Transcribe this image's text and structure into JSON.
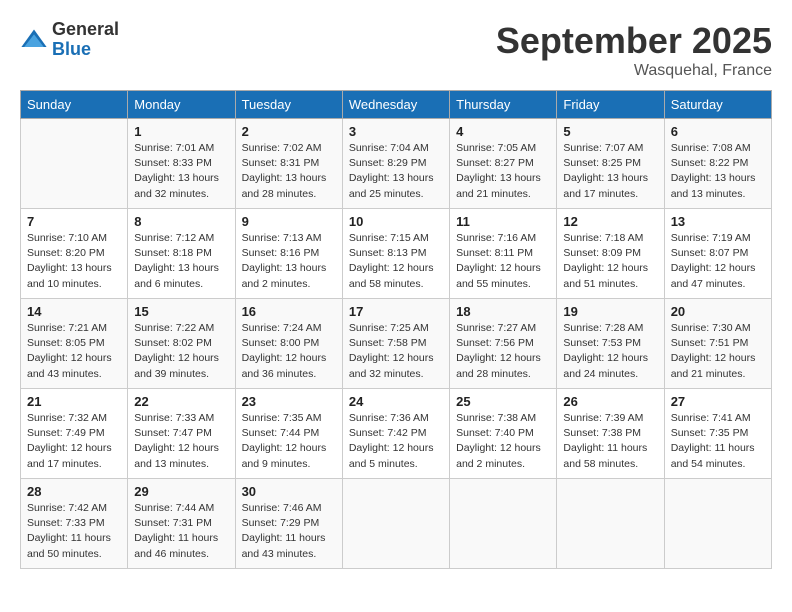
{
  "logo": {
    "general": "General",
    "blue": "Blue"
  },
  "title": "September 2025",
  "subtitle": "Wasquehal, France",
  "days_header": [
    "Sunday",
    "Monday",
    "Tuesday",
    "Wednesday",
    "Thursday",
    "Friday",
    "Saturday"
  ],
  "weeks": [
    [
      {
        "num": "",
        "info": ""
      },
      {
        "num": "1",
        "info": "Sunrise: 7:01 AM\nSunset: 8:33 PM\nDaylight: 13 hours\nand 32 minutes."
      },
      {
        "num": "2",
        "info": "Sunrise: 7:02 AM\nSunset: 8:31 PM\nDaylight: 13 hours\nand 28 minutes."
      },
      {
        "num": "3",
        "info": "Sunrise: 7:04 AM\nSunset: 8:29 PM\nDaylight: 13 hours\nand 25 minutes."
      },
      {
        "num": "4",
        "info": "Sunrise: 7:05 AM\nSunset: 8:27 PM\nDaylight: 13 hours\nand 21 minutes."
      },
      {
        "num": "5",
        "info": "Sunrise: 7:07 AM\nSunset: 8:25 PM\nDaylight: 13 hours\nand 17 minutes."
      },
      {
        "num": "6",
        "info": "Sunrise: 7:08 AM\nSunset: 8:22 PM\nDaylight: 13 hours\nand 13 minutes."
      }
    ],
    [
      {
        "num": "7",
        "info": "Sunrise: 7:10 AM\nSunset: 8:20 PM\nDaylight: 13 hours\nand 10 minutes."
      },
      {
        "num": "8",
        "info": "Sunrise: 7:12 AM\nSunset: 8:18 PM\nDaylight: 13 hours\nand 6 minutes."
      },
      {
        "num": "9",
        "info": "Sunrise: 7:13 AM\nSunset: 8:16 PM\nDaylight: 13 hours\nand 2 minutes."
      },
      {
        "num": "10",
        "info": "Sunrise: 7:15 AM\nSunset: 8:13 PM\nDaylight: 12 hours\nand 58 minutes."
      },
      {
        "num": "11",
        "info": "Sunrise: 7:16 AM\nSunset: 8:11 PM\nDaylight: 12 hours\nand 55 minutes."
      },
      {
        "num": "12",
        "info": "Sunrise: 7:18 AM\nSunset: 8:09 PM\nDaylight: 12 hours\nand 51 minutes."
      },
      {
        "num": "13",
        "info": "Sunrise: 7:19 AM\nSunset: 8:07 PM\nDaylight: 12 hours\nand 47 minutes."
      }
    ],
    [
      {
        "num": "14",
        "info": "Sunrise: 7:21 AM\nSunset: 8:05 PM\nDaylight: 12 hours\nand 43 minutes."
      },
      {
        "num": "15",
        "info": "Sunrise: 7:22 AM\nSunset: 8:02 PM\nDaylight: 12 hours\nand 39 minutes."
      },
      {
        "num": "16",
        "info": "Sunrise: 7:24 AM\nSunset: 8:00 PM\nDaylight: 12 hours\nand 36 minutes."
      },
      {
        "num": "17",
        "info": "Sunrise: 7:25 AM\nSunset: 7:58 PM\nDaylight: 12 hours\nand 32 minutes."
      },
      {
        "num": "18",
        "info": "Sunrise: 7:27 AM\nSunset: 7:56 PM\nDaylight: 12 hours\nand 28 minutes."
      },
      {
        "num": "19",
        "info": "Sunrise: 7:28 AM\nSunset: 7:53 PM\nDaylight: 12 hours\nand 24 minutes."
      },
      {
        "num": "20",
        "info": "Sunrise: 7:30 AM\nSunset: 7:51 PM\nDaylight: 12 hours\nand 21 minutes."
      }
    ],
    [
      {
        "num": "21",
        "info": "Sunrise: 7:32 AM\nSunset: 7:49 PM\nDaylight: 12 hours\nand 17 minutes."
      },
      {
        "num": "22",
        "info": "Sunrise: 7:33 AM\nSunset: 7:47 PM\nDaylight: 12 hours\nand 13 minutes."
      },
      {
        "num": "23",
        "info": "Sunrise: 7:35 AM\nSunset: 7:44 PM\nDaylight: 12 hours\nand 9 minutes."
      },
      {
        "num": "24",
        "info": "Sunrise: 7:36 AM\nSunset: 7:42 PM\nDaylight: 12 hours\nand 5 minutes."
      },
      {
        "num": "25",
        "info": "Sunrise: 7:38 AM\nSunset: 7:40 PM\nDaylight: 12 hours\nand 2 minutes."
      },
      {
        "num": "26",
        "info": "Sunrise: 7:39 AM\nSunset: 7:38 PM\nDaylight: 11 hours\nand 58 minutes."
      },
      {
        "num": "27",
        "info": "Sunrise: 7:41 AM\nSunset: 7:35 PM\nDaylight: 11 hours\nand 54 minutes."
      }
    ],
    [
      {
        "num": "28",
        "info": "Sunrise: 7:42 AM\nSunset: 7:33 PM\nDaylight: 11 hours\nand 50 minutes."
      },
      {
        "num": "29",
        "info": "Sunrise: 7:44 AM\nSunset: 7:31 PM\nDaylight: 11 hours\nand 46 minutes."
      },
      {
        "num": "30",
        "info": "Sunrise: 7:46 AM\nSunset: 7:29 PM\nDaylight: 11 hours\nand 43 minutes."
      },
      {
        "num": "",
        "info": ""
      },
      {
        "num": "",
        "info": ""
      },
      {
        "num": "",
        "info": ""
      },
      {
        "num": "",
        "info": ""
      }
    ]
  ]
}
